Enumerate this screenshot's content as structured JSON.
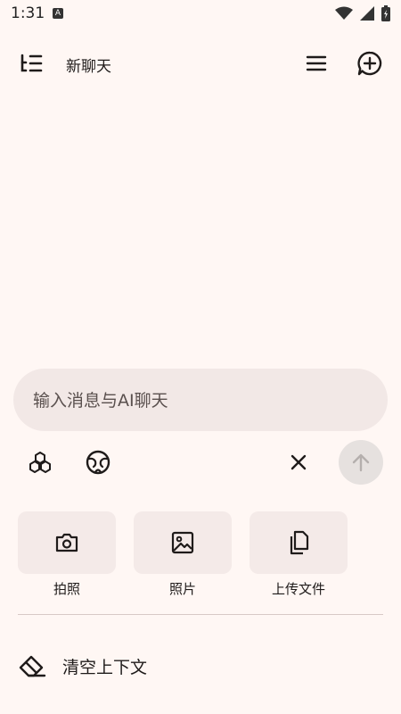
{
  "status_bar": {
    "time": "1:31",
    "badge": "A"
  },
  "app_bar": {
    "title": "新聊天"
  },
  "input": {
    "placeholder": "输入消息与AI聊天"
  },
  "attachments": [
    {
      "label": "拍照",
      "icon": "camera-icon"
    },
    {
      "label": "照片",
      "icon": "image-icon"
    },
    {
      "label": "上传文件",
      "icon": "files-icon"
    }
  ],
  "clear_context": {
    "label": "清空上下文",
    "icon": "eraser-icon"
  },
  "colors": {
    "background": "#FFF7F4",
    "input_bg": "#F2E8E6",
    "tile_bg": "#F4EAE8",
    "send_bg": "#E6E1DF"
  }
}
